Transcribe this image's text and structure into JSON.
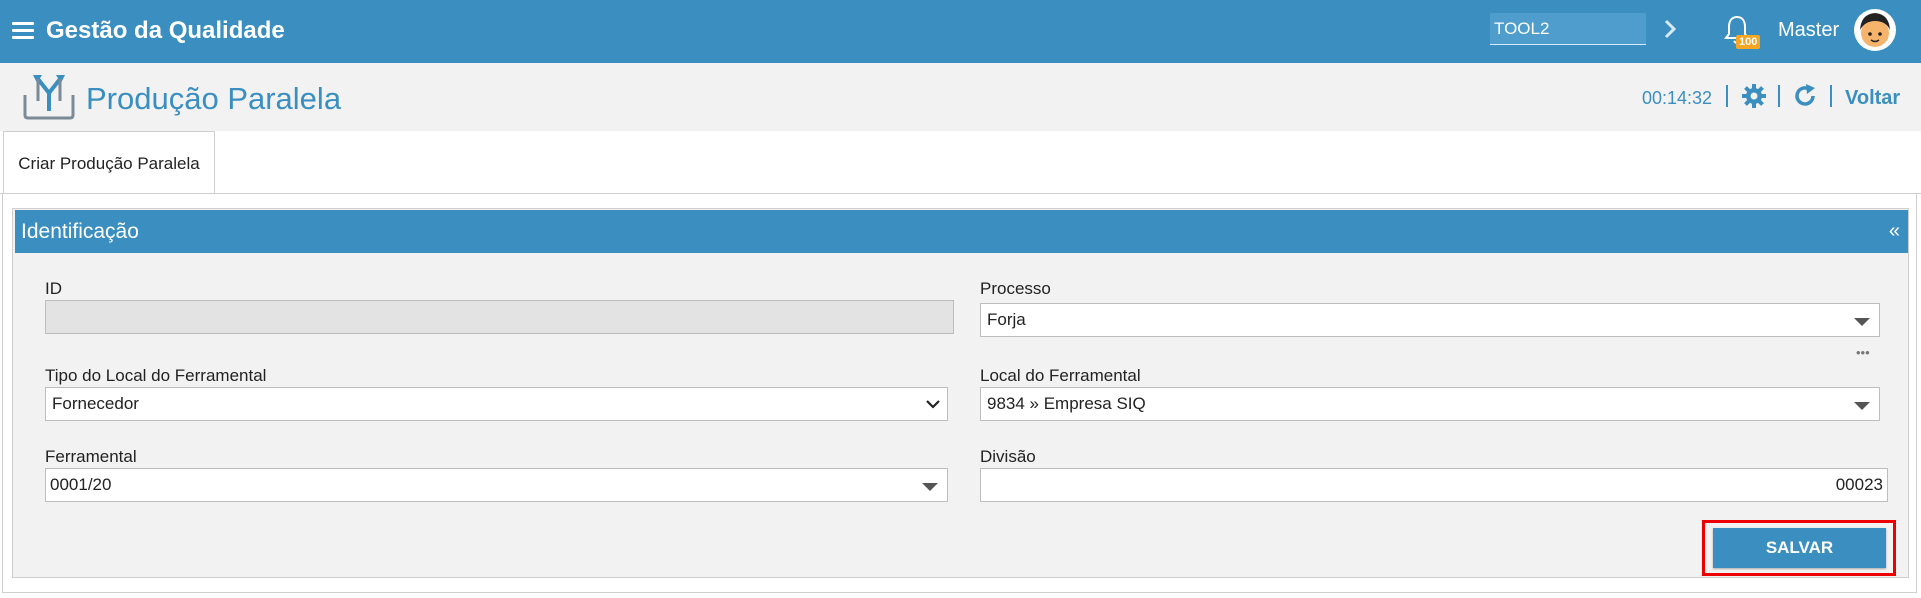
{
  "header": {
    "app_title": "Gestão da Qualidade",
    "search_value": "TOOL2",
    "notifications_count": "100",
    "user_name": "Master"
  },
  "page": {
    "title": "Produção Paralela",
    "timer": "00:14:32",
    "back_label": "Voltar"
  },
  "tabs": [
    {
      "label": "Criar Produção Paralela"
    }
  ],
  "panel": {
    "title": "Identificação",
    "collapse_glyph": "«"
  },
  "form": {
    "id": {
      "label": "ID",
      "value": ""
    },
    "processo": {
      "label": "Processo",
      "value": "Forja"
    },
    "tipo_local": {
      "label": "Tipo do Local do Ferramental",
      "value": "Fornecedor"
    },
    "local_ferramental": {
      "label": "Local do Ferramental",
      "value": "9834 » Empresa SIQ"
    },
    "ferramental": {
      "label": "Ferramental",
      "value": "0001/20"
    },
    "divisao": {
      "label": "Divisão",
      "value": "00023"
    },
    "more_glyph": "•••",
    "save_label": "SALVAR"
  },
  "colors": {
    "primary": "#3b8fc0",
    "badge": "#f5a623",
    "highlight": "#e00000"
  }
}
